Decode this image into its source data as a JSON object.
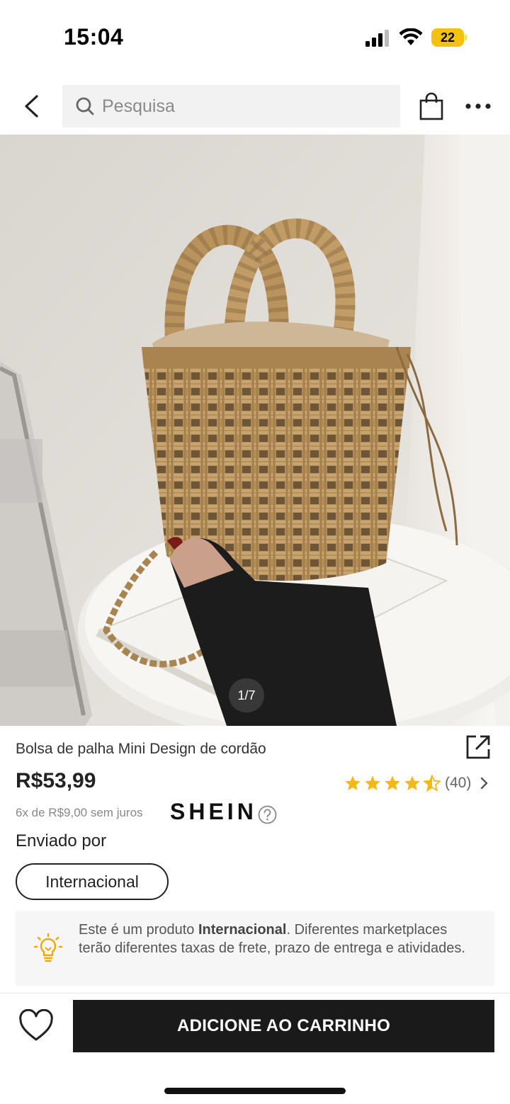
{
  "status_bar": {
    "time": "15:04",
    "battery": "22",
    "icons": [
      "signal-icon",
      "wifi-icon",
      "battery-icon"
    ],
    "battery_color": "#f4c20d"
  },
  "nav": {
    "search_placeholder": "Pesquisa",
    "icons": [
      "back-arrow-icon",
      "search-icon",
      "shopping-bag-icon",
      "more-dots-icon"
    ]
  },
  "gallery": {
    "page_indicator": "1/7",
    "current": 1,
    "total": 7
  },
  "product": {
    "title": "Bolsa de palha Mini Design de cordão",
    "price": "R$53,99",
    "rating": 4.5,
    "rating_count": "(40)",
    "installments": "6x de R$9,00 sem juros",
    "seller_logo": "SHEIN",
    "shipped_by_label": "Enviado por",
    "shipping_origin": "Internacional"
  },
  "notice": {
    "text_before": "Este é um produto ",
    "text_bold": "Internacional",
    "text_after": ". Diferentes marketplaces terão diferentes taxas de frete, prazo de entrega e atividades."
  },
  "bottom_bar": {
    "add_to_cart": "ADICIONE AO CARRINHO"
  },
  "colors": {
    "star": "#f5b819",
    "button_bg": "#1a1a1a",
    "notice_bg": "#f6f6f6"
  }
}
